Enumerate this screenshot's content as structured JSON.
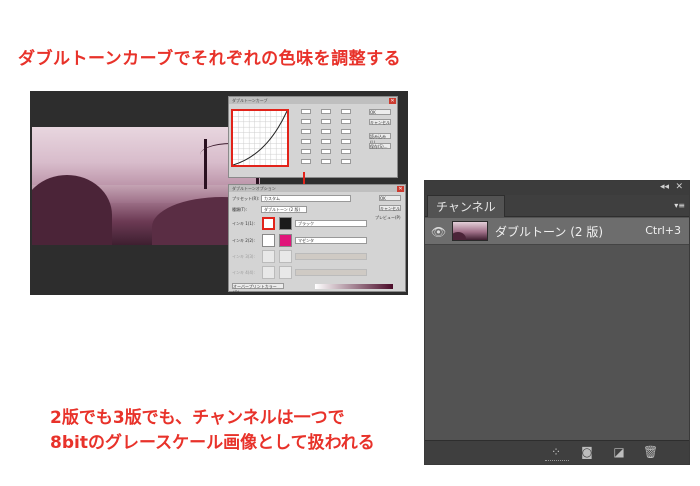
{
  "annotations": {
    "headline": "ダブルトーンカーブでそれぞれの色味を調整する",
    "note_line1": "2版でも3版でも、チャンネルは一つで",
    "note_line2": "8bitのグレースケール画像として扱われる"
  },
  "curve_dialog": {
    "title": "ダブルトーンカーブ",
    "close": "✕",
    "btn_ok": "OK",
    "btn_cancel": "キャンセル",
    "btn_load": "読み込み(L)...",
    "btn_save": "保存(S)..."
  },
  "duotone_dialog": {
    "title": "ダブルトーンオプション",
    "close": "✕",
    "preset_label": "プリセット(R):",
    "preset_value": "カスタム",
    "type_label": "種類(T):",
    "type_value": "ダブルトーン (2 版)",
    "ink1_label": "インキ 1(1):",
    "ink1_name": "ブラック",
    "ink2_label": "インキ 2(2):",
    "ink2_name": "マゼンタ",
    "ink3_label": "インキ 3(3):",
    "ink4_label": "インキ 4(4):",
    "btn_ok": "OK",
    "btn_cancel": "キャンセル",
    "preview": "プレビュー(P)",
    "overprint": "オーバープリントカラー(O)...",
    "ink1_color": "#1a1a1a",
    "ink2_color": "#e0157a"
  },
  "channels_panel": {
    "collapse": "◂◂",
    "close": "✕",
    "tab": "チャンネル",
    "menu": "▾≡",
    "channel_name": "ダブルトーン (2 版)",
    "shortcut": "Ctrl+3"
  }
}
